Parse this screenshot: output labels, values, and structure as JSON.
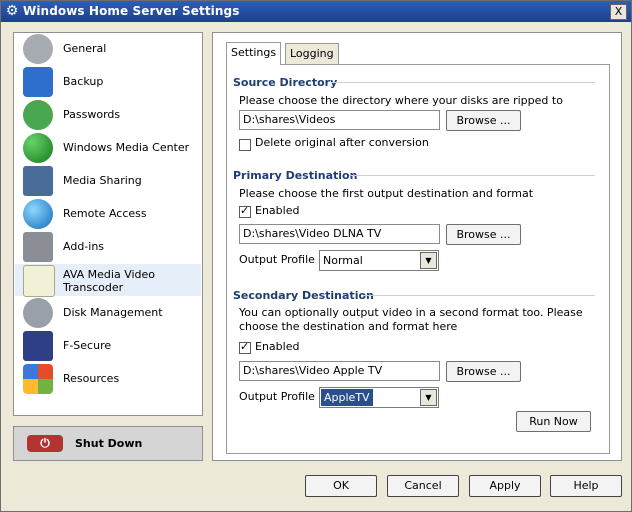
{
  "window": {
    "title": "Windows Home Server Settings",
    "close_glyph": "X"
  },
  "sidebar": {
    "items": [
      {
        "label": "General",
        "icon": "gear-icon"
      },
      {
        "label": "Backup",
        "icon": "backup-icon"
      },
      {
        "label": "Passwords",
        "icon": "passwords-icon"
      },
      {
        "label": "Windows Media Center",
        "icon": "media-center-icon"
      },
      {
        "label": "Media Sharing",
        "icon": "media-sharing-icon"
      },
      {
        "label": "Remote Access",
        "icon": "remote-access-icon"
      },
      {
        "label": "Add-ins",
        "icon": "addins-icon"
      },
      {
        "label_line1": "AVA Media Video",
        "label_line2": "Transcoder",
        "icon": "transcoder-icon"
      },
      {
        "label": "Disk Management",
        "icon": "disk-management-icon"
      },
      {
        "label": "F-Secure",
        "icon": "fsecure-icon"
      },
      {
        "label": "Resources",
        "icon": "resources-icon"
      }
    ],
    "shutdown_label": "Shut Down"
  },
  "tabs": [
    "Settings",
    "Logging"
  ],
  "source": {
    "title": "Source Directory",
    "instructions": "Please choose the directory where your disks are ripped to",
    "path": "D:\\shares\\Videos",
    "browse": "Browse ...",
    "delete_label": "Delete original after conversion"
  },
  "primary": {
    "title": "Primary Destination",
    "instructions": "Please choose the first output destination and format",
    "enabled_label": "Enabled",
    "path": "D:\\shares\\Video DLNA TV",
    "browse": "Browse ...",
    "profile_label": "Output Profile",
    "profile_value": "Normal"
  },
  "secondary": {
    "title": "Secondary Destination",
    "instructions_line1": "You can optionally output video in a second format too. Please",
    "instructions_line2": "choose the destination and format here",
    "enabled_label": "Enabled",
    "path": "D:\\shares\\Video Apple TV",
    "browse": "Browse ...",
    "profile_label": "Output Profile",
    "profile_value": "AppleTV"
  },
  "run_now": "Run Now",
  "footer": {
    "ok": "OK",
    "cancel": "Cancel",
    "apply": "Apply",
    "help": "Help"
  }
}
